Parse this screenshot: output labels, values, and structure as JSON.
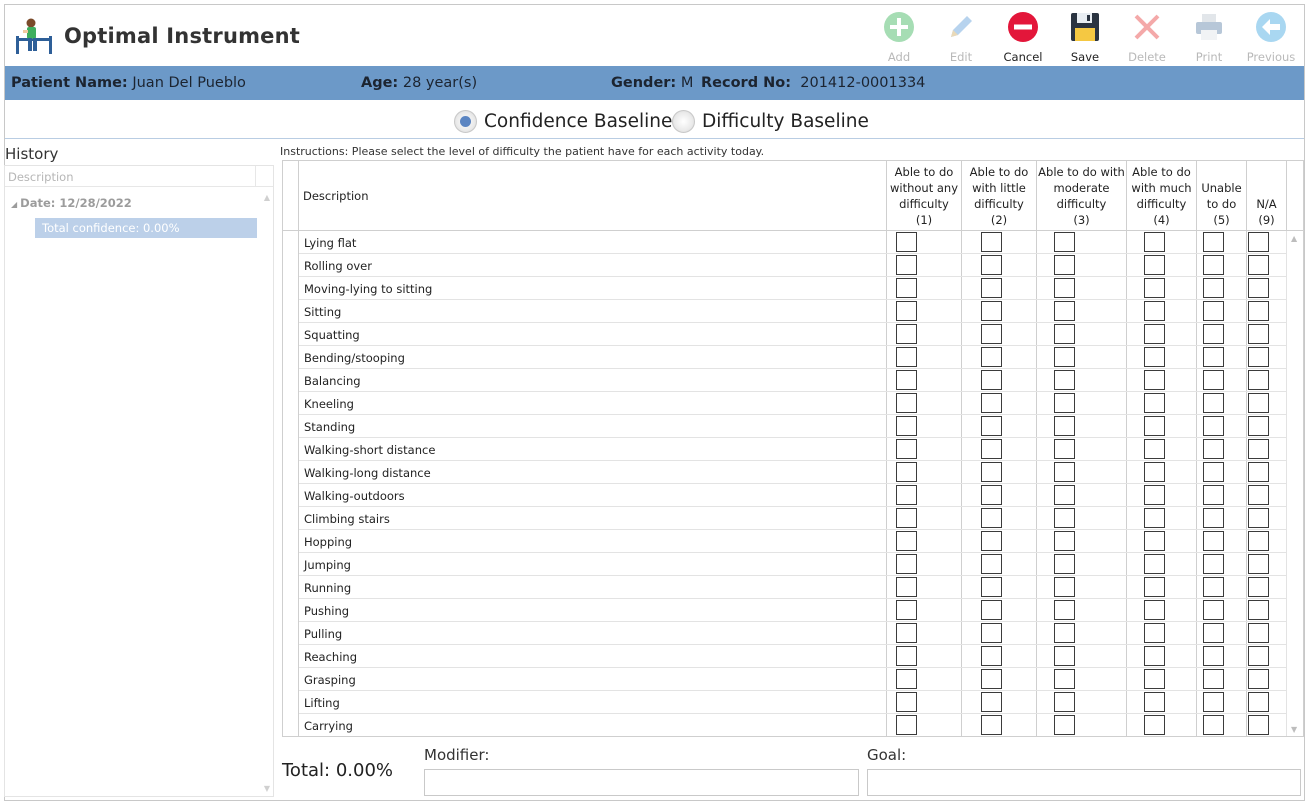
{
  "app": {
    "title": "Optimal Instrument"
  },
  "toolbar": [
    {
      "id": "add",
      "label": "Add",
      "icon": "plus-icon",
      "enabled": false
    },
    {
      "id": "edit",
      "label": "Edit",
      "icon": "pencil-icon",
      "enabled": false
    },
    {
      "id": "cancel",
      "label": "Cancel",
      "icon": "cancel-icon",
      "enabled": true
    },
    {
      "id": "save",
      "label": "Save",
      "icon": "save-icon",
      "enabled": true
    },
    {
      "id": "delete",
      "label": "Delete",
      "icon": "delete-icon",
      "enabled": false
    },
    {
      "id": "print",
      "label": "Print",
      "icon": "printer-icon",
      "enabled": false
    },
    {
      "id": "previous",
      "label": "Previous",
      "icon": "arrow-left-icon",
      "enabled": false
    }
  ],
  "patient": {
    "name_label": "Patient Name:",
    "name": "Juan Del Pueblo",
    "age_label": "Age:",
    "age": "28 year(s)",
    "gender_label": "Gender:",
    "gender": "M",
    "record_label": "Record No:",
    "record": "201412-0001334"
  },
  "baseline": {
    "options": [
      {
        "label": "Confidence Baseline",
        "selected": true
      },
      {
        "label": "Difficulty Baseline",
        "selected": false
      }
    ]
  },
  "history": {
    "title": "History",
    "column": "Description",
    "date_label": "Date: 12/28/2022",
    "entry": "Total confidence: 0.00%"
  },
  "instructions": "Instructions: Please select the level of difficulty the patient have for each activity today.",
  "grid": {
    "desc_header": "Description",
    "columns": [
      {
        "lines": [
          "Able to do",
          "without any",
          "difficulty",
          "(1)"
        ]
      },
      {
        "lines": [
          "Able to do",
          "with little",
          "difficulty",
          "(2)"
        ]
      },
      {
        "lines": [
          "Able to do with",
          "moderate",
          "difficulty",
          "(3)"
        ]
      },
      {
        "lines": [
          "Able to do",
          "with much",
          "difficulty",
          "(4)"
        ]
      },
      {
        "lines": [
          "Unable",
          "to do",
          "(5)"
        ]
      },
      {
        "lines": [
          "N/A",
          "(9)"
        ]
      }
    ],
    "rows": [
      "Lying flat",
      "Rolling over",
      "Moving-lying to sitting",
      "Sitting",
      "Squatting",
      "Bending/stooping",
      "Balancing",
      "Kneeling",
      "Standing",
      "Walking-short distance",
      "Walking-long distance",
      "Walking-outdoors",
      "Climbing stairs",
      "Hopping",
      "Jumping",
      "Running",
      "Pushing",
      "Pulling",
      "Reaching",
      "Grasping",
      "Lifting",
      "Carrying"
    ]
  },
  "footer": {
    "total": "Total: 0.00%",
    "modifier_label": "Modifier:",
    "modifier_value": "",
    "goal_label": "Goal:",
    "goal_value": ""
  },
  "colors": {
    "accent": "#6c99c8",
    "selection": "#bcd0e9",
    "cancel": "#e3163a",
    "add": "#4cbb6b"
  }
}
